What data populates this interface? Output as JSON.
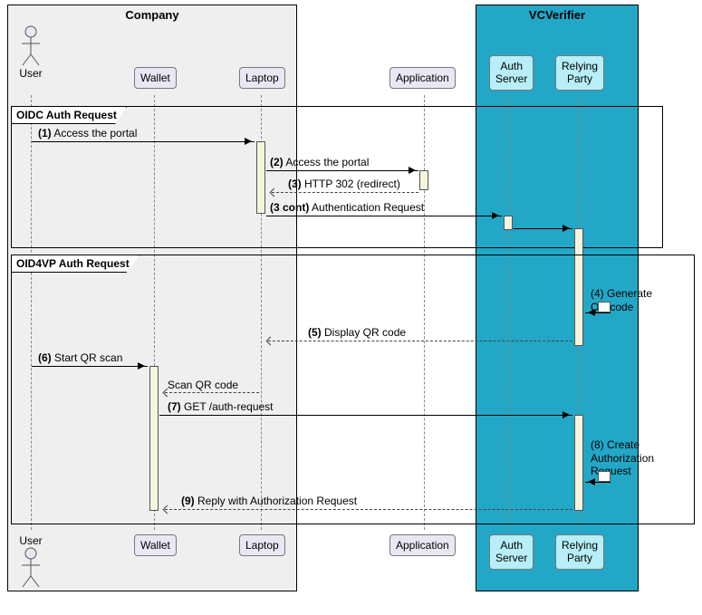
{
  "groups": {
    "company": "Company",
    "vcverifier": "VCVerifier"
  },
  "actors": {
    "user_top": "User",
    "user_bottom": "User"
  },
  "participants": {
    "wallet_top": "Wallet",
    "laptop_top": "Laptop",
    "application_top": "Application",
    "authserver_top": "Auth\nServer",
    "relyingparty_top": "Relying\nParty",
    "wallet_bottom": "Wallet",
    "laptop_bottom": "Laptop",
    "application_bottom": "Application",
    "authserver_bottom": "Auth\nServer",
    "relyingparty_bottom": "Relying\nParty"
  },
  "frames": {
    "oidc": "OIDC Auth Request",
    "oid4vp": "OID4VP Auth Request"
  },
  "messages": {
    "m1_num": "(1)",
    "m1_text": " Access the portal",
    "m2_num": "(2)",
    "m2_text": " Access the portal",
    "m3_num": "(3)",
    "m3_text": " HTTP 302 (redirect)",
    "m3c_num": "(3 cont)",
    "m3c_text": " Authentication Request",
    "m4_num": "(4)",
    "m4_text": " Generate\nQR code",
    "m5_num": "(5)",
    "m5_text": " Display QR code",
    "m6_num": "(6)",
    "m6_text": " Start QR scan",
    "scan_text": "Scan QR code",
    "m7_num": "(7)",
    "m7_text": " GET /auth-request",
    "m8_num": "(8)",
    "m8_text": " Create\nAuthorization\nRequest",
    "m9_num": "(9)",
    "m9_text": " Reply with Authorization Request"
  }
}
